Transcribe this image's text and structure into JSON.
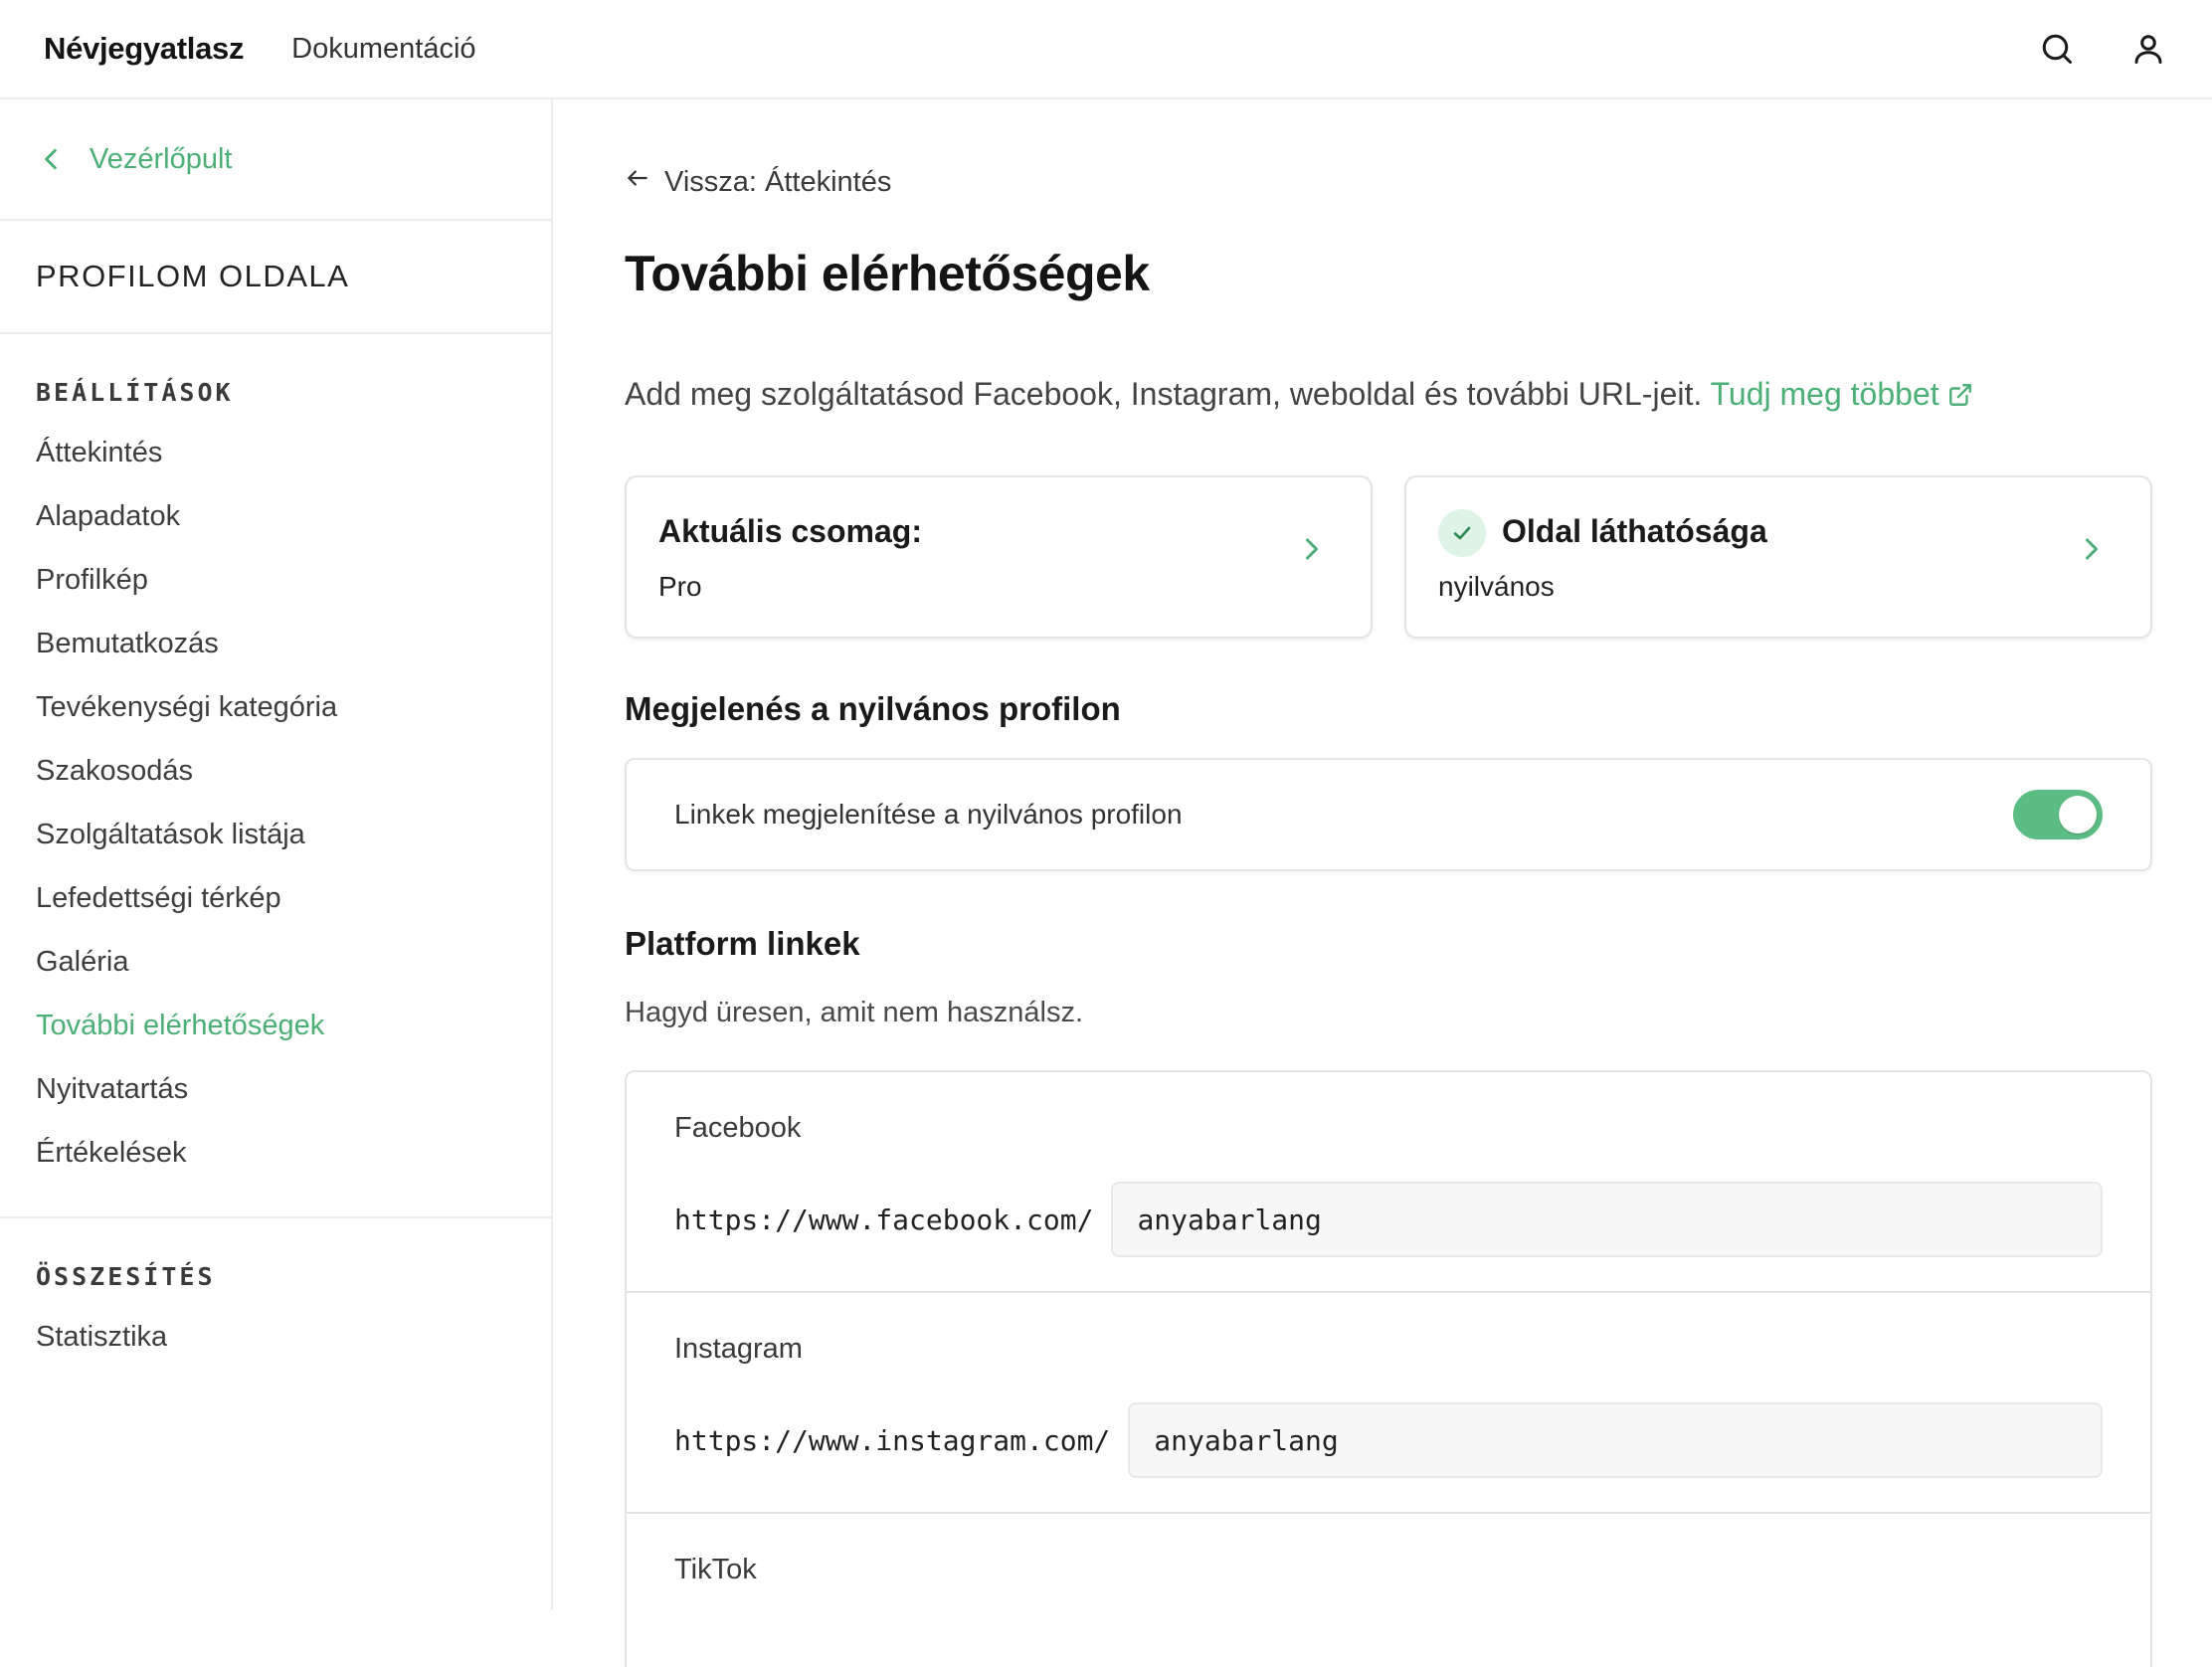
{
  "header": {
    "brand": "Névjegyatlasz",
    "nav_docs": "Dokumentáció",
    "search_icon": "search-icon",
    "user_icon": "user-icon"
  },
  "sidebar": {
    "back_label": "Vezérlőpult",
    "profile_title": "PROFILOM OLDALA",
    "settings_heading": "BEÁLLÍTÁSOK",
    "settings_items": [
      "Áttekintés",
      "Alapadatok",
      "Profilkép",
      "Bemutatkozás",
      "Tevékenységi kategória",
      "Szakosodás",
      "Szolgáltatások listája",
      "Lefedettségi térkép",
      "Galéria",
      "További elérhetőségek",
      "Nyitvatartás",
      "Értékelések"
    ],
    "active_item": "További elérhetőségek",
    "summary_heading": "ÖSSZESÍTÉS",
    "summary_items": [
      "Statisztika"
    ]
  },
  "main": {
    "back_link": "Vissza: Áttekintés",
    "title": "További elérhetőségek",
    "intro": "Add meg szolgáltatásod Facebook, Instagram, weboldal és további URL-jeit.",
    "learn_more": "Tudj meg többet",
    "plan_card": {
      "title": "Aktuális csomag:",
      "value": "Pro"
    },
    "visibility_card": {
      "title": "Oldal láthatósága",
      "value": "nyilvános"
    },
    "public_heading": "Megjelenés a nyilvános profilon",
    "toggle_label": "Linkek megjelenítése a nyilvános profilon",
    "toggle_on": true,
    "platform_heading": "Platform linkek",
    "platform_hint": "Hagyd üresen, amit nem használsz.",
    "links": [
      {
        "name": "Facebook",
        "prefix": "https://www.facebook.com/",
        "value": "anyabarlang"
      },
      {
        "name": "Instagram",
        "prefix": "https://www.instagram.com/",
        "value": "anyabarlang"
      },
      {
        "name": "TikTok",
        "prefix": "",
        "value": ""
      }
    ]
  },
  "colors": {
    "accent": "#4caf76",
    "toggle": "#5cbd84",
    "border": "#e4e4e4"
  }
}
